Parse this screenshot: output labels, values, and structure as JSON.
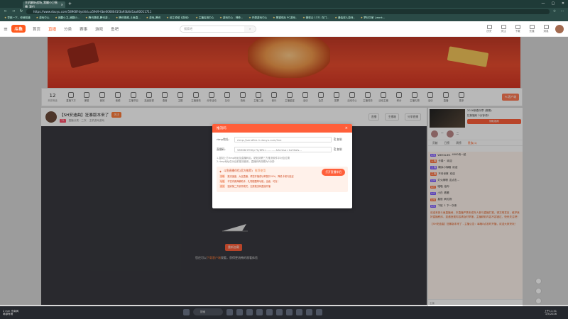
{
  "browser": {
    "tab_title": "主机解析战场_我翻小卫直播_我行",
    "url": "https://www.douyu.com/58968?dyshid=a59d9-0be0068041f3a93b6d1aa00011711",
    "bookmarks": [
      "导航一下，你就知道",
      "游戏中心",
      "我翻小卫_我翻小...",
      "腾讯视频_腾讯游...",
      "腾讯视频_斗鱼直...",
      "游戏_腾讯",
      "设立领域《游戏》",
      "主播应用中心",
      "游戏中心 - 神奇...",
      "开源游戏中心",
      "黑猫领兵 PC游戏..",
      "微软云 1371 在门...",
      "通话双人游戏..",
      "梦幻中家 | work..."
    ]
  },
  "site": {
    "logo": "斗鱼",
    "nav": [
      "首页",
      "直播",
      "分类",
      "赛事",
      "游戏",
      "鱼吧"
    ],
    "active_nav": "直播",
    "search_placeholder": "搜索吧",
    "header_icons": [
      "历史",
      "关注",
      "下载",
      "充值",
      "消息"
    ],
    "message_badge": "9"
  },
  "toolbar": {
    "level_num": "12",
    "level_label": "贵族等级",
    "tools": [
      "直播下方",
      "弹幕",
      "音效",
      "音频",
      "主播节目",
      "高级影视",
      "语音",
      "主题",
      "主播音效",
      "分享活动",
      "互动",
      "拍卖",
      "主播二级",
      "音乐",
      "主播星星",
      "活动",
      "会员",
      "发票",
      "活动中心",
      "主播任务",
      "活动主播",
      "积分",
      "主播礼物",
      "活动",
      "直播",
      "更多"
    ],
    "pc_button": "PC客户端"
  },
  "stream": {
    "title": "【SH安迪曲】狂暴版本来了",
    "follow_label": "关注",
    "tag": "72",
    "meta": [
      "直播分类 · 二次",
      "主机游戏游戏"
    ],
    "right_labels": [
      "直播",
      "主播端",
      "分享直播"
    ],
    "reload_button": "重新加载",
    "hint_before": "您还可以",
    "hint_link": "下载客户端",
    "hint_after": "观看，获得更流畅的观看体验"
  },
  "sidebar": {
    "ad_title": "2026新春乐章 (赛期)",
    "ad_sub": "拉新福利 2分钟领1",
    "ad_button": "领取福利",
    "rank_items": [
      "一",
      "二"
    ],
    "tabs": [
      "贡献",
      "日榜",
      "周榜",
      "贵族(1)"
    ],
    "active_tab": "贵族(1)",
    "chat": [
      {
        "user": "WEEKLIES",
        "badge": "LV8",
        "text": "4000块一起"
      },
      {
        "user": "卡锦~",
        "badge": "主播",
        "text": "欢迎"
      },
      {
        "user": "糊涂小咖喱",
        "badge": "主播",
        "text": "欢迎"
      },
      {
        "user": "不问世事",
        "badge": "主播",
        "text": "欢迎"
      },
      {
        "user": "灯火阑珊",
        "badge": "LV9",
        "text": "这点击..."
      },
      {
        "user": "喵喵",
        "badge": "LV7",
        "text": "给你"
      },
      {
        "user": "小白",
        "badge": "LV5",
        "text": "看看"
      },
      {
        "user": "星辰",
        "badge": "LV6",
        "text": "刷礼物"
      },
      {
        "user": "下班",
        "badge": "LV4",
        "text": "1 下一次来"
      }
    ],
    "notice": "欢迎来到斗鱼直播间，本直播严禁未成年人参与直播打赏，请文明发言，维护良好直播秩序，如遇违规内容请及时举报，主播精彩内容不容错过，快来关注吧！",
    "announcement": "【SH安迪曲】狂暴版本来了 - 主播公告：每晚8点准时开播，欢迎大家来玩！",
    "chat_input_placeholder": "主播"
  },
  "modal": {
    "title": "推流码",
    "rtmp_label": "rtmp地址:",
    "rtmp_value": "rtmp://sendfire-1.douyu.com/live",
    "key_label": "直播码:",
    "key_value": "58968rYEWyr?ty6Rt=...........&fcrbsa=1a30a&...",
    "copy_label": "复制",
    "tips": [
      "1.复制上方rtmp地址及直播码后，粘贴到第三方推流软件中对应位置",
      "2.rtmp地址仅为目前推流使用，直播码有效期为5分钟"
    ],
    "promo_title": "斗鱼直播伴侣(官方推荐)",
    "promo_sub": "推荐使用",
    "open_button": "打开直播伴侣",
    "promo_lines": [
      {
        "k": "清晰",
        "v": "推流速度、大区直播，帮您开播成功率提升20%，降低卡顿与延迟"
      },
      {
        "k": "功能",
        "v": "丰富内置弹幕助手、礼物提醒等功能，全面、可靠！"
      },
      {
        "k": "高效",
        "v": "独家第二方软件模式，无需推流码直接开播"
      }
    ]
  },
  "taskbar": {
    "weather_temp": "2 mm 东南风",
    "weather_desc": "局部有雨",
    "search": "搜索",
    "time": "上午11:31",
    "date": "1/5/2026"
  }
}
